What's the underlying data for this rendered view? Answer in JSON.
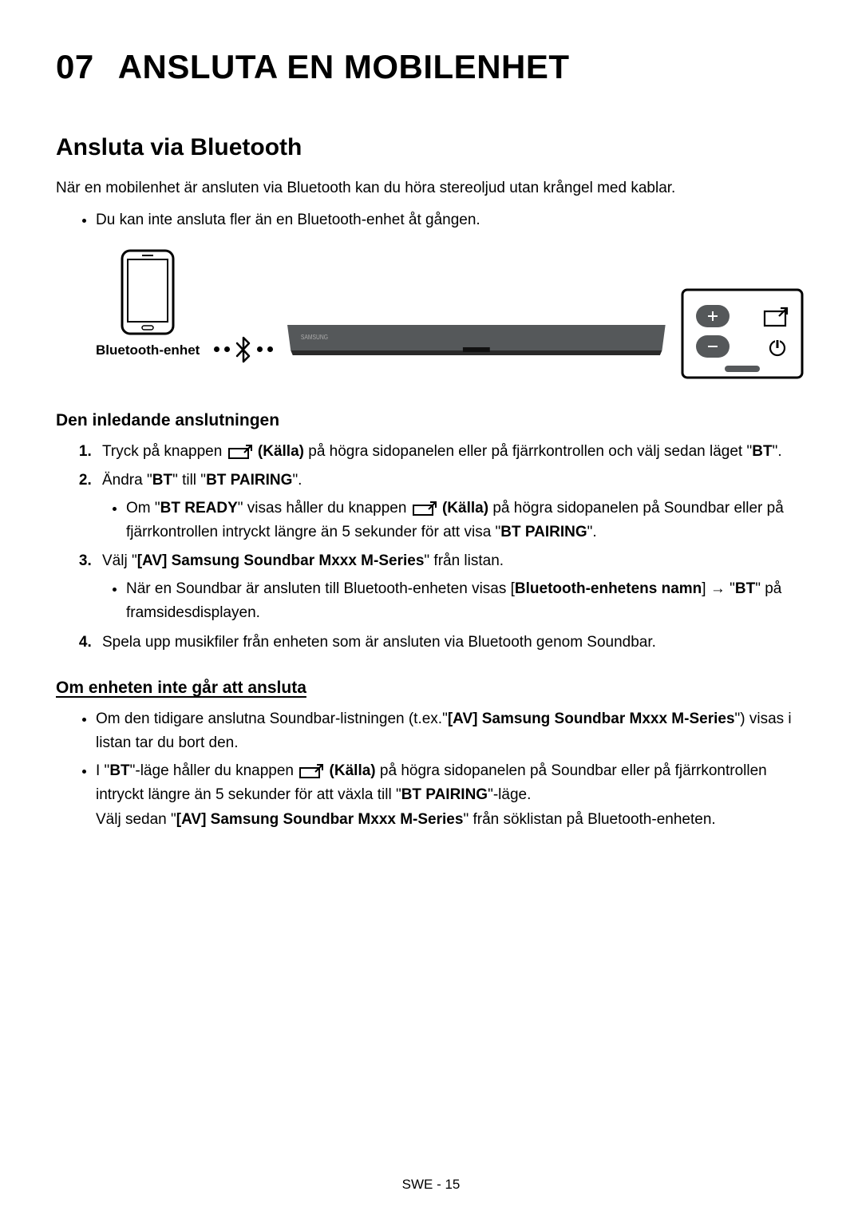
{
  "chapter": {
    "number": "07",
    "title": "ANSLUTA EN MOBILENHET"
  },
  "section": {
    "title": "Ansluta via Bluetooth"
  },
  "intro": "När en mobilenhet är ansluten via Bluetooth kan du höra stereoljud utan krångel med kablar.",
  "intro_bullet": "Du kan inte ansluta fler än en Bluetooth-enhet åt gången.",
  "diagram": {
    "phone_label": "Bluetooth-enhet"
  },
  "source_label": "(Källa)",
  "initial": {
    "title": "Den inledande anslutningen",
    "step1_a": "Tryck på knappen ",
    "step1_b": " på högra sidopanelen eller på fjärrkontrollen och välj sedan läget \"",
    "step1_c": "BT",
    "step1_d": "\".",
    "step2_a": "Ändra \"",
    "step2_b": "BT",
    "step2_c": "\" till \"",
    "step2_d": "BT PAIRING",
    "step2_e": "\".",
    "step2_sub_a": "Om \"",
    "step2_sub_b": "BT READY",
    "step2_sub_c": "\" visas håller du knappen ",
    "step2_sub_d": " på högra sidopanelen på Soundbar eller på fjärrkontrollen intryckt längre än 5 sekunder för att visa \"",
    "step2_sub_e": "BT PAIRING",
    "step2_sub_f": "\".",
    "step3_a": "Välj \"",
    "step3_b": "[AV] Samsung Soundbar Mxxx M-Series",
    "step3_c": "\"  från listan.",
    "step3_sub_a": "När en Soundbar är ansluten till Bluetooth-enheten visas [",
    "step3_sub_b": "Bluetooth-enhetens namn",
    "step3_sub_c": "] → \"",
    "step3_sub_d": "BT",
    "step3_sub_e": "\" på framsidesdisplayen.",
    "step4": "Spela upp musikfiler från enheten som är ansluten via Bluetooth genom Soundbar."
  },
  "trouble": {
    "title": "Om enheten inte går att ansluta",
    "b1_a": "Om den tidigare anslutna Soundbar-listningen (t.ex.\"",
    "b1_b": "[AV] Samsung Soundbar Mxxx M-Series",
    "b1_c": "\") visas i listan tar du bort den.",
    "b2_a": "I \"",
    "b2_b": "BT",
    "b2_c": "\"-läge håller du knappen ",
    "b2_d": " på högra sidopanelen på Soundbar eller på fjärrkontrollen intryckt längre än 5 sekunder för att växla till \"",
    "b2_e": "BT PAIRING",
    "b2_f": "\"-läge.",
    "b2_g": "Välj sedan \"",
    "b2_h": "[AV] Samsung Soundbar Mxxx M-Series",
    "b2_i": "\" från söklistan på Bluetooth-enheten."
  },
  "footer": "SWE - 15"
}
